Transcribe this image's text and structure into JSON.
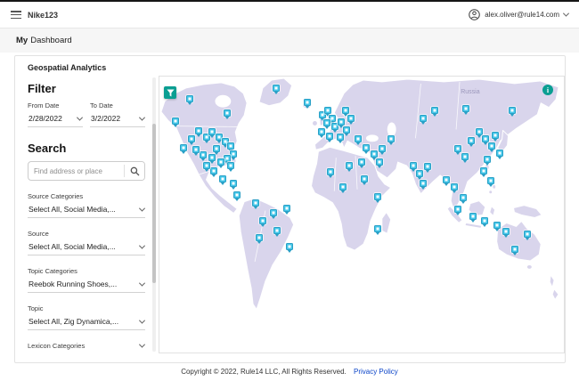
{
  "page": {
    "topbar": {
      "brand": "Nike123",
      "user_email": "alex.oliver@rule14.com"
    },
    "breadcrumb": {
      "bold": "My",
      "rest": "Dashboard"
    },
    "card": {
      "title": "Geospatial Analytics"
    },
    "filter": {
      "heading": "Filter",
      "from": {
        "label": "From Date",
        "value": "2/28/2022"
      },
      "to": {
        "label": "To Date",
        "value": "3/2/2022"
      }
    },
    "search": {
      "heading": "Search",
      "placeholder": "Find address or place"
    },
    "dropdowns": [
      {
        "label": "Source Categories",
        "value": "Select All, Social Media,..."
      },
      {
        "label": "Source",
        "value": "Select All, Social Media,..."
      },
      {
        "label": "Topic Categories",
        "value": "Reebok Running Shoes,..."
      },
      {
        "label": "Topic",
        "value": "Select All, Zig Dynamica,..."
      },
      {
        "label": "Lexicon Categories",
        "value": ""
      }
    ],
    "map": {
      "label_russia": "Russia",
      "colors": {
        "land": "#d9d5ec",
        "marker": "#45c7e9",
        "marker_border": "#2aa0c6",
        "accent": "#0a9e92"
      },
      "markers": [
        [
          7.4,
          9.3
        ],
        [
          16.8,
          14.4
        ],
        [
          3.9,
          17.3
        ],
        [
          5.9,
          27.2
        ],
        [
          7.9,
          24
        ],
        [
          9.6,
          21.1
        ],
        [
          11.6,
          23.3
        ],
        [
          13.1,
          21.4
        ],
        [
          14.8,
          23.3
        ],
        [
          16.2,
          24.9
        ],
        [
          17.7,
          26.5
        ],
        [
          18.3,
          29.4
        ],
        [
          16.8,
          31
        ],
        [
          15.1,
          32.3
        ],
        [
          13.1,
          30.7
        ],
        [
          10.9,
          29.7
        ],
        [
          9,
          27.8
        ],
        [
          14.2,
          27.5
        ],
        [
          17.7,
          33.5
        ],
        [
          13.5,
          35.5
        ],
        [
          11.6,
          33.5
        ],
        [
          15.7,
          38.3
        ],
        [
          18.3,
          39.9
        ],
        [
          19.2,
          44.1
        ],
        [
          28.8,
          5.4
        ],
        [
          36.5,
          10.5
        ],
        [
          23.8,
          47
        ],
        [
          25.5,
          53.4
        ],
        [
          28.2,
          50.5
        ],
        [
          31.4,
          48.9
        ],
        [
          29,
          57.2
        ],
        [
          24.7,
          59.7
        ],
        [
          32.1,
          62.9
        ],
        [
          40.2,
          15
        ],
        [
          41.7,
          13.4
        ],
        [
          42.8,
          16.3
        ],
        [
          41.3,
          18.2
        ],
        [
          43.4,
          19.5
        ],
        [
          45,
          17.9
        ],
        [
          46.3,
          20.8
        ],
        [
          40,
          21.4
        ],
        [
          42.1,
          23
        ],
        [
          44.8,
          23.3
        ],
        [
          47.4,
          16.3
        ],
        [
          46.1,
          13.7
        ],
        [
          42.4,
          35.8
        ],
        [
          46.9,
          33.5
        ],
        [
          50,
          32.3
        ],
        [
          50.7,
          38.3
        ],
        [
          53.9,
          44.7
        ],
        [
          53.9,
          56.5
        ],
        [
          45.4,
          41.2
        ],
        [
          49.1,
          24
        ],
        [
          51.1,
          27.2
        ],
        [
          53.1,
          29.4
        ],
        [
          55,
          27.5
        ],
        [
          54.4,
          32.3
        ],
        [
          57.2,
          24
        ],
        [
          65.3,
          16.3
        ],
        [
          68.1,
          13.7
        ],
        [
          75.8,
          12.8
        ],
        [
          87.3,
          13.4
        ],
        [
          62.7,
          33.5
        ],
        [
          64.4,
          36.4
        ],
        [
          66.2,
          33.9
        ],
        [
          65.1,
          39.9
        ],
        [
          71,
          38.7
        ],
        [
          72.9,
          41.2
        ],
        [
          75.1,
          45
        ],
        [
          73.8,
          49.5
        ],
        [
          77.5,
          51.8
        ],
        [
          80.3,
          53.4
        ],
        [
          83.4,
          55.3
        ],
        [
          73.8,
          27.5
        ],
        [
          75.5,
          30.4
        ],
        [
          77.1,
          24.6
        ],
        [
          79,
          21.4
        ],
        [
          80.6,
          24
        ],
        [
          82.1,
          26.5
        ],
        [
          83,
          22.7
        ],
        [
          84.1,
          29.1
        ],
        [
          81,
          31.3
        ],
        [
          80.1,
          35.5
        ],
        [
          81.9,
          39
        ],
        [
          85.6,
          57.5
        ],
        [
          91,
          58.5
        ],
        [
          87.8,
          63.9
        ]
      ]
    },
    "footer": {
      "copyright": "Copyright © 2022, Rule14 LLC, All Rights Reserved.",
      "privacy": "Privacy Policy"
    }
  }
}
